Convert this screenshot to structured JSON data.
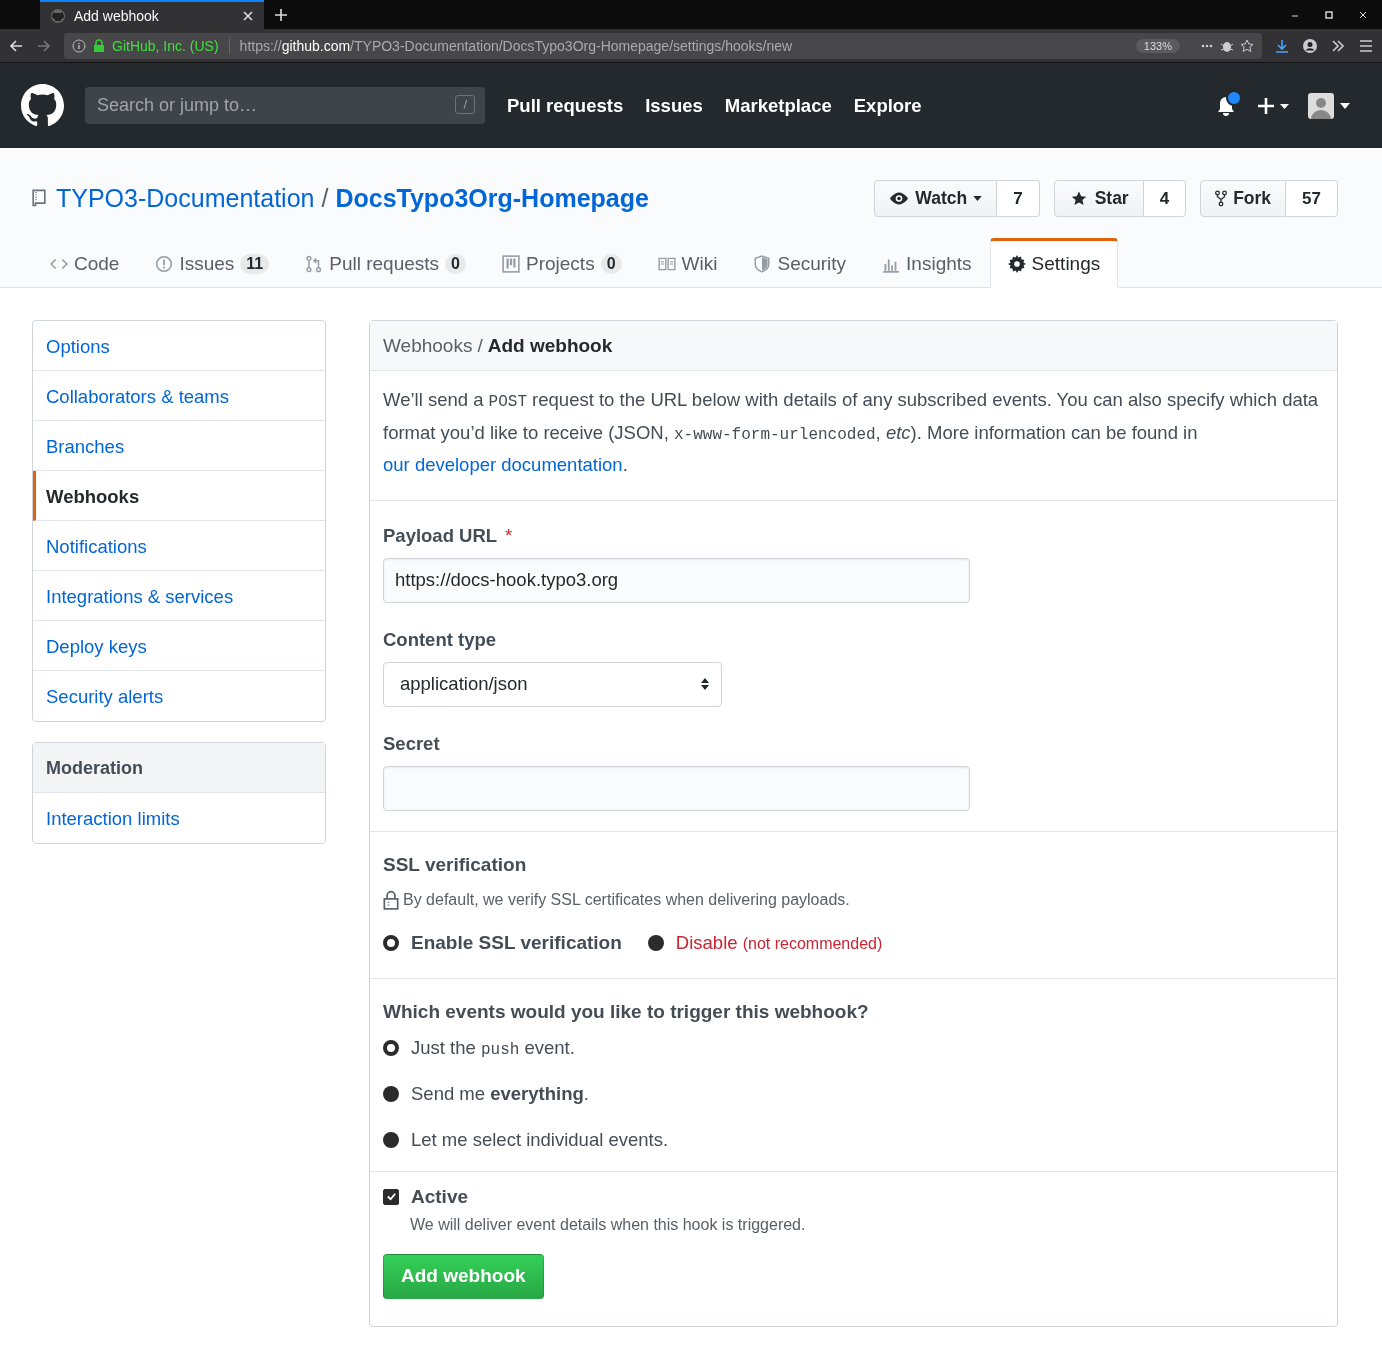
{
  "browser": {
    "tab_title": "Add webhook",
    "site_identity": "GitHub, Inc. (US)",
    "url_scheme": "https://",
    "url_host": "github.com",
    "url_path": "/TYPO3-Documentation/DocsTypo3Org-Homepage/settings/hooks/new",
    "zoom": "133%"
  },
  "header": {
    "search_placeholder": "Search or jump to…",
    "search_key": "/",
    "nav": [
      "Pull requests",
      "Issues",
      "Marketplace",
      "Explore"
    ],
    "has_notification": true
  },
  "repo": {
    "owner": "TYPO3-Documentation",
    "separator": "/",
    "name": "DocsTypo3Org-Homepage",
    "actions": [
      {
        "kind": "watch",
        "label": "Watch",
        "count": "7",
        "dropdown": true
      },
      {
        "kind": "star",
        "label": "Star",
        "count": "4",
        "dropdown": false
      },
      {
        "kind": "fork",
        "label": "Fork",
        "count": "57",
        "dropdown": false
      }
    ]
  },
  "tabs": [
    {
      "kind": "code",
      "label": "Code",
      "selected": false
    },
    {
      "kind": "issues",
      "label": "Issues",
      "count": "11",
      "selected": false
    },
    {
      "kind": "pulls",
      "label": "Pull requests",
      "count": "0",
      "selected": false
    },
    {
      "kind": "projects",
      "label": "Projects",
      "count": "0",
      "selected": false
    },
    {
      "kind": "wiki",
      "label": "Wiki",
      "selected": false
    },
    {
      "kind": "security",
      "label": "Security",
      "selected": false
    },
    {
      "kind": "insights",
      "label": "Insights",
      "selected": false
    },
    {
      "kind": "settings",
      "label": "Settings",
      "selected": true
    }
  ],
  "sidebar": {
    "items": [
      {
        "label": "Options",
        "selected": false
      },
      {
        "label": "Collaborators & teams",
        "selected": false
      },
      {
        "label": "Branches",
        "selected": false
      },
      {
        "label": "Webhooks",
        "selected": true
      },
      {
        "label": "Notifications",
        "selected": false
      },
      {
        "label": "Integrations & services",
        "selected": false
      },
      {
        "label": "Deploy keys",
        "selected": false
      },
      {
        "label": "Security alerts",
        "selected": false
      }
    ],
    "moderation": {
      "heading": "Moderation",
      "items": [
        {
          "label": "Interaction limits",
          "selected": false
        }
      ]
    }
  },
  "panel": {
    "breadcrumb_parent": "Webhooks",
    "breadcrumb_separator": "/",
    "title": "Add webhook",
    "intro": [
      {
        "kind": "text",
        "text": "We’ll send a "
      },
      {
        "kind": "code",
        "text": "POST"
      },
      {
        "kind": "text",
        "text": " request to the URL below with details of any subscribed events. You can also specify which data format you’d like to receive (JSON, "
      },
      {
        "kind": "code",
        "text": "x-www-form-urlencoded"
      },
      {
        "kind": "text",
        "text": ", "
      },
      {
        "kind": "italic",
        "text": "etc"
      },
      {
        "kind": "text",
        "text": "). More information can be found in "
      },
      {
        "kind": "link",
        "text": "our developer documentation"
      },
      {
        "kind": "text",
        "text": "."
      }
    ],
    "payload_label": "Payload URL",
    "required_mark": "*",
    "payload_value": "https://docs-hook.typo3.org",
    "content_type_label": "Content type",
    "content_type_value": "application/json",
    "secret_label": "Secret",
    "ssl_heading": "SSL verification",
    "ssl_note": "By default, we verify SSL certificates when delivering payloads.",
    "ssl_options": [
      {
        "kind": "enable",
        "label": "Enable SSL verification",
        "selected": true
      },
      {
        "kind": "disable",
        "label": "Disable",
        "note": "(not recommended)",
        "selected": false
      }
    ],
    "events_heading": "Which events would you like to trigger this webhook?",
    "events": [
      {
        "parts": [
          {
            "kind": "text",
            "text": "Just the "
          },
          {
            "kind": "code",
            "text": "push"
          },
          {
            "kind": "text",
            "text": " event."
          }
        ],
        "selected": true
      },
      {
        "parts": [
          {
            "kind": "rich",
            "text": "Send me **everything**."
          }
        ],
        "selected": false
      },
      {
        "parts": [
          {
            "kind": "text",
            "text": "Let me select individual events."
          }
        ],
        "selected": false
      }
    ],
    "active_label": "Active",
    "active_checked": true,
    "active_note": "We will deliver event details when this hook is triggered.",
    "submit": "Add webhook"
  }
}
